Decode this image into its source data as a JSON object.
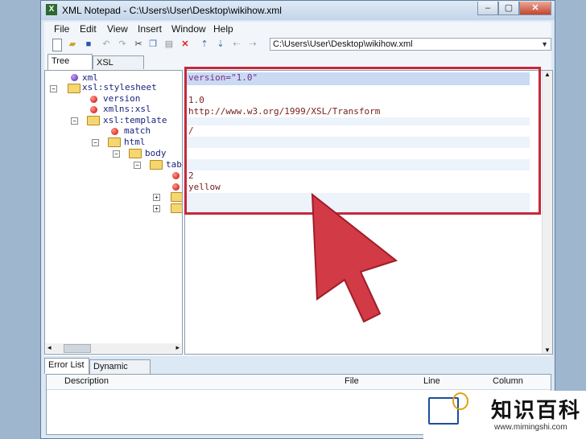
{
  "window": {
    "title": "XML Notepad - C:\\Users\\User\\Desktop\\wikihow.xml",
    "app_icon": "X",
    "minimize": "–",
    "maximize": "▢",
    "close": "✕"
  },
  "menu": [
    "File",
    "Edit",
    "View",
    "Insert",
    "Window",
    "Help"
  ],
  "toolbar": {
    "icons": [
      "new-file-icon",
      "open-folder-icon",
      "save-icon",
      "undo-icon",
      "redo-icon",
      "cut-icon",
      "copy-icon",
      "paste-icon",
      "delete-icon",
      "nudge-up-icon",
      "nudge-down-icon",
      "nudge-left-icon",
      "nudge-right-icon"
    ],
    "path": "C:\\Users\\User\\Desktop\\wikihow.xml"
  },
  "tabs": {
    "tree_view": "Tree View",
    "xsl_output": "XSL Output"
  },
  "tree": [
    {
      "label": "xml",
      "type": "pi"
    },
    {
      "label": "xsl:stylesheet",
      "type": "element"
    },
    {
      "label": "version",
      "type": "attribute"
    },
    {
      "label": "xmlns:xsl",
      "type": "attribute"
    },
    {
      "label": "xsl:template",
      "type": "element"
    },
    {
      "label": "match",
      "type": "attribute"
    },
    {
      "label": "html",
      "type": "element"
    },
    {
      "label": "body",
      "type": "element"
    },
    {
      "label": "tab",
      "type": "element"
    }
  ],
  "values": {
    "row0": "version=\"1.0\"",
    "row1": "",
    "row2": "1.0",
    "row3": "http://www.w3.org/1999/XSL/Transform",
    "row4": "",
    "row5": "/",
    "row8": "2",
    "row9": "yellow"
  },
  "bottom_tabs": {
    "error_list": "Error List",
    "dynamic_help": "Dynamic Help"
  },
  "error_columns": [
    "Description",
    "File",
    "Line",
    "Column"
  ],
  "watermark": {
    "title": "知识百科",
    "url": "www.mimingshi.com"
  },
  "colors": {
    "highlight": "#c5283a",
    "arrow": "#d23a45"
  }
}
